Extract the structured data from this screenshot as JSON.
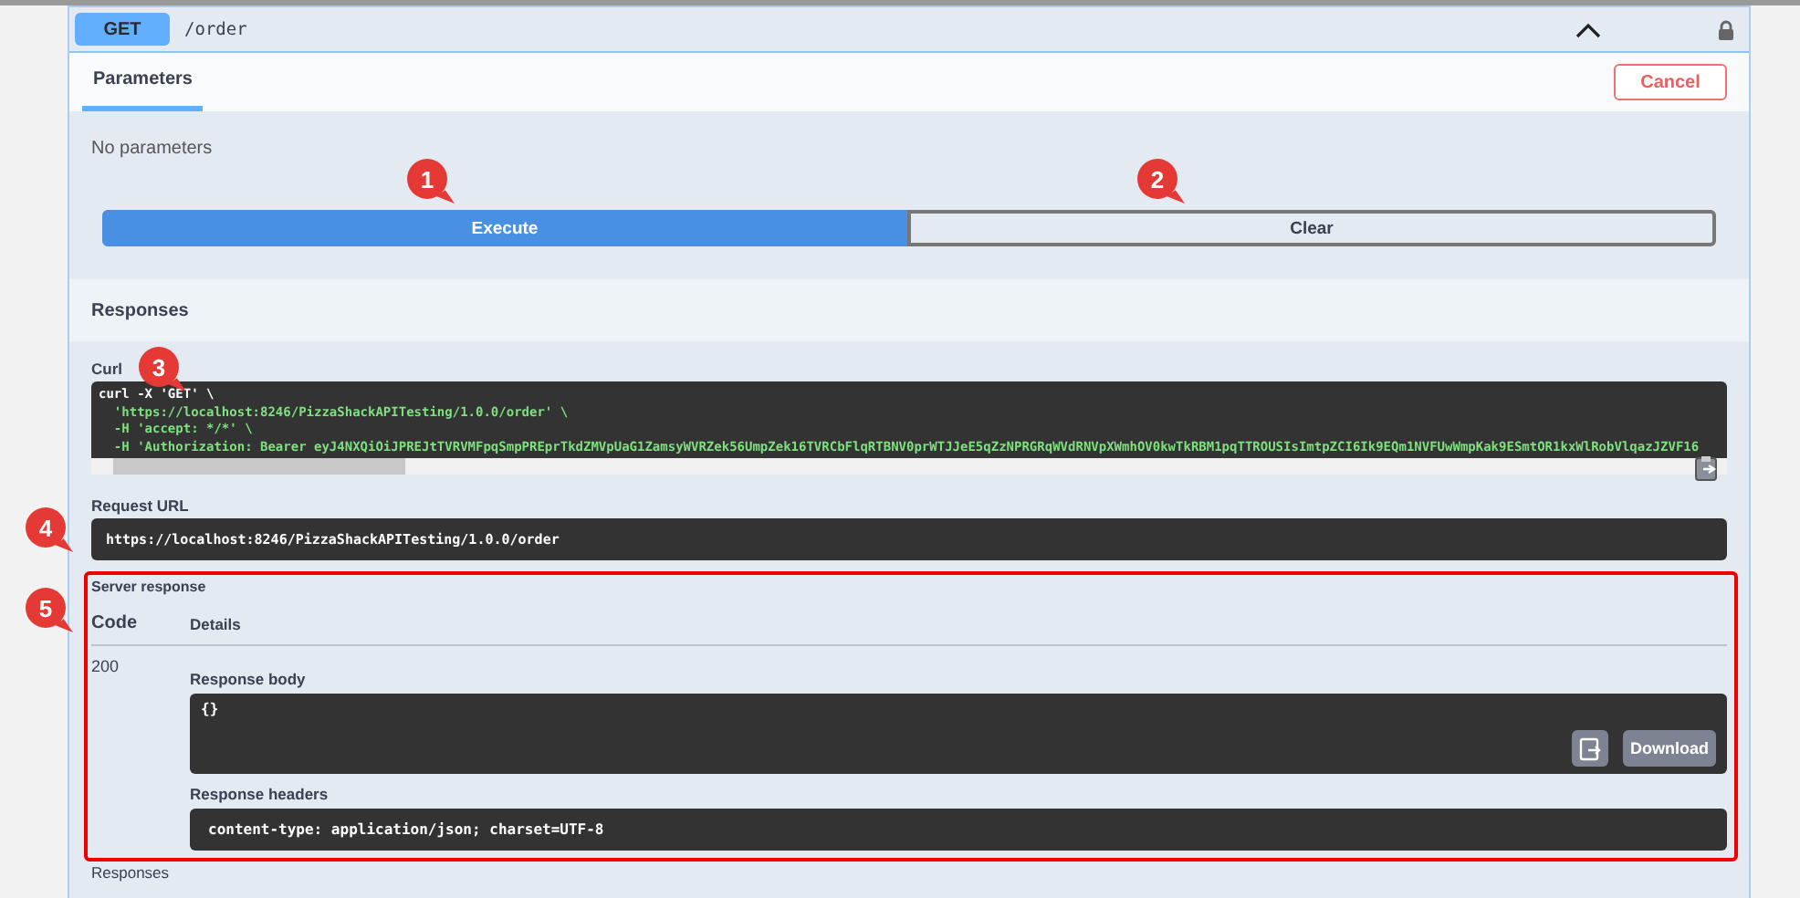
{
  "operation": {
    "method": "GET",
    "path": "/order"
  },
  "tabs": [
    {
      "label": "Parameters",
      "selected": true
    }
  ],
  "cancel_button": "Cancel",
  "parameters_message": "No parameters",
  "actions": [
    {
      "label": "Execute",
      "kind": "primary"
    },
    {
      "label": "Clear",
      "kind": "secondary"
    }
  ],
  "responses_header": "Responses",
  "curl": {
    "label": "Curl",
    "lines": [
      "curl -X 'GET' \\",
      "  'https://localhost:8246/PizzaShackAPITesting/1.0.0/order' \\",
      "  -H 'accept: */*' \\",
      "  -H 'Authorization: Bearer eyJ4NXQiOiJPREJtTVRVMFpqSmpPREprTkdZMVpUaG1ZamsyWVRZek56UmpZek16TVRCbFlqRTBNV0prWTJJeE5qZzNPRGRqWVdRNVpXWmhOV0kwTkRBM1pqTTROUSIsImtpZCI6Ik9EQm1NVFUwWmpKak9ESmtOR1kxWlRobVlqazJZVF16"
    ]
  },
  "request_url": {
    "label": "Request URL",
    "value": "https://localhost:8246/PizzaShackAPITesting/1.0.0/order"
  },
  "server_response": {
    "label": "Server response",
    "columns": [
      "Code",
      "Details"
    ],
    "code": "200",
    "body_label": "Response body",
    "body": "{}",
    "download_button": "Download",
    "headers_label": "Response headers",
    "headers": "content-type: application/json; charset=UTF-8"
  },
  "footer_label": "Responses",
  "callouts": [
    "1",
    "2",
    "3",
    "4",
    "5"
  ]
}
